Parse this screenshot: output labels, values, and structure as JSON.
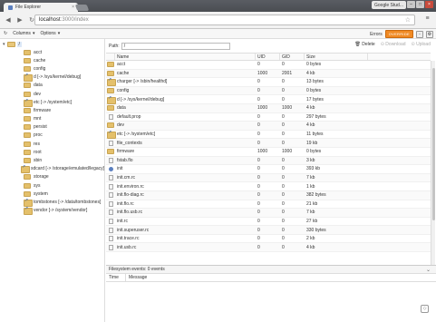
{
  "browser": {
    "tab_title": "File Explorer",
    "tab_close": "×",
    "profile": "Google Stud...",
    "minimize": "–",
    "maximize": "□",
    "close": "×",
    "url_host": "localhost",
    "url_path": ":3000/index",
    "back": "◀",
    "forward": "▶",
    "reload": "↻",
    "star": "☆",
    "menu": "≡"
  },
  "toolbar": {
    "refresh": "↻",
    "columns": "Columns",
    "options": "Options",
    "caret": "▾",
    "errors": "Errors",
    "badge": "OVERRIDE",
    "zoom": "-",
    "settings": "⚙"
  },
  "path": {
    "label": "Path:",
    "value": "/"
  },
  "actions": {
    "delete": "Delete",
    "download": "Download",
    "upload": "Upload"
  },
  "sidebar": {
    "root_label": "/",
    "items": [
      {
        "label": "acct",
        "type": "folder"
      },
      {
        "label": "cache",
        "type": "folder"
      },
      {
        "label": "config",
        "type": "folder"
      },
      {
        "label": "d [-> /sys/kernel/debug]",
        "type": "link"
      },
      {
        "label": "data",
        "type": "folder"
      },
      {
        "label": "dev",
        "type": "folder"
      },
      {
        "label": "etc [-> /system/etc]",
        "type": "link"
      },
      {
        "label": "firmware",
        "type": "folder"
      },
      {
        "label": "mnt",
        "type": "folder"
      },
      {
        "label": "persist",
        "type": "folder"
      },
      {
        "label": "proc",
        "type": "folder"
      },
      {
        "label": "res",
        "type": "folder"
      },
      {
        "label": "root",
        "type": "folder"
      },
      {
        "label": "sbin",
        "type": "folder"
      },
      {
        "label": "sdcard [-> /storage/emulated/legacy]",
        "type": "link"
      },
      {
        "label": "storage",
        "type": "folder"
      },
      {
        "label": "sys",
        "type": "folder"
      },
      {
        "label": "system",
        "type": "folder"
      },
      {
        "label": "tombstones [-> /data/tombstones]",
        "type": "link"
      },
      {
        "label": "vendor [-> /system/vendor]",
        "type": "link"
      }
    ]
  },
  "table": {
    "headers": {
      "name": "Name",
      "uid": "UID",
      "gid": "GID",
      "size": "Size"
    },
    "rows": [
      {
        "name": "acct",
        "uid": "0",
        "gid": "0",
        "size": "0 bytes",
        "type": "folder"
      },
      {
        "name": "cache",
        "uid": "1000",
        "gid": "2001",
        "size": "4 kb",
        "type": "folder"
      },
      {
        "name": "charger [-> /sbin/healthd]",
        "uid": "0",
        "gid": "0",
        "size": "13 bytes",
        "type": "link"
      },
      {
        "name": "config",
        "uid": "0",
        "gid": "0",
        "size": "0 bytes",
        "type": "folder"
      },
      {
        "name": "d [-> /sys/kernel/debug]",
        "uid": "0",
        "gid": "0",
        "size": "17 bytes",
        "type": "link"
      },
      {
        "name": "data",
        "uid": "1000",
        "gid": "1000",
        "size": "4 kb",
        "type": "folder"
      },
      {
        "name": "default.prop",
        "uid": "0",
        "gid": "0",
        "size": "297 bytes",
        "type": "file"
      },
      {
        "name": "dev",
        "uid": "0",
        "gid": "0",
        "size": "4 kb",
        "type": "folder"
      },
      {
        "name": "etc [-> /system/etc]",
        "uid": "0",
        "gid": "0",
        "size": "11 bytes",
        "type": "link"
      },
      {
        "name": "file_contexts",
        "uid": "0",
        "gid": "0",
        "size": "19 kb",
        "type": "file"
      },
      {
        "name": "firmware",
        "uid": "1000",
        "gid": "1000",
        "size": "0 bytes",
        "type": "folder"
      },
      {
        "name": "fstab.flo",
        "uid": "0",
        "gid": "0",
        "size": "3 kb",
        "type": "file"
      },
      {
        "name": "init",
        "uid": "0",
        "gid": "0",
        "size": "393 kb",
        "type": "exec"
      },
      {
        "name": "init.cm.rc",
        "uid": "0",
        "gid": "0",
        "size": "7 kb",
        "type": "file"
      },
      {
        "name": "init.environ.rc",
        "uid": "0",
        "gid": "0",
        "size": "1 kb",
        "type": "file"
      },
      {
        "name": "init.flo-diag.rc",
        "uid": "0",
        "gid": "0",
        "size": "382 bytes",
        "type": "file"
      },
      {
        "name": "init.flo.rc",
        "uid": "0",
        "gid": "0",
        "size": "21 kb",
        "type": "file"
      },
      {
        "name": "init.flo.usb.rc",
        "uid": "0",
        "gid": "0",
        "size": "7 kb",
        "type": "file"
      },
      {
        "name": "init.rc",
        "uid": "0",
        "gid": "0",
        "size": "27 kb",
        "type": "file"
      },
      {
        "name": "init.superuser.rc",
        "uid": "0",
        "gid": "0",
        "size": "330 bytes",
        "type": "file"
      },
      {
        "name": "init.trace.rc",
        "uid": "0",
        "gid": "0",
        "size": "2 kb",
        "type": "file"
      },
      {
        "name": "init.usb.rc",
        "uid": "0",
        "gid": "0",
        "size": "4 kb",
        "type": "file"
      }
    ]
  },
  "events": {
    "title": "Filesystem events: 0 events",
    "chevron": "⌄",
    "col_time": "Time",
    "col_message": "Message"
  },
  "colors": {
    "accent": "#f08a24",
    "folder": "#e4c06b",
    "link": "#2b5fb0"
  }
}
